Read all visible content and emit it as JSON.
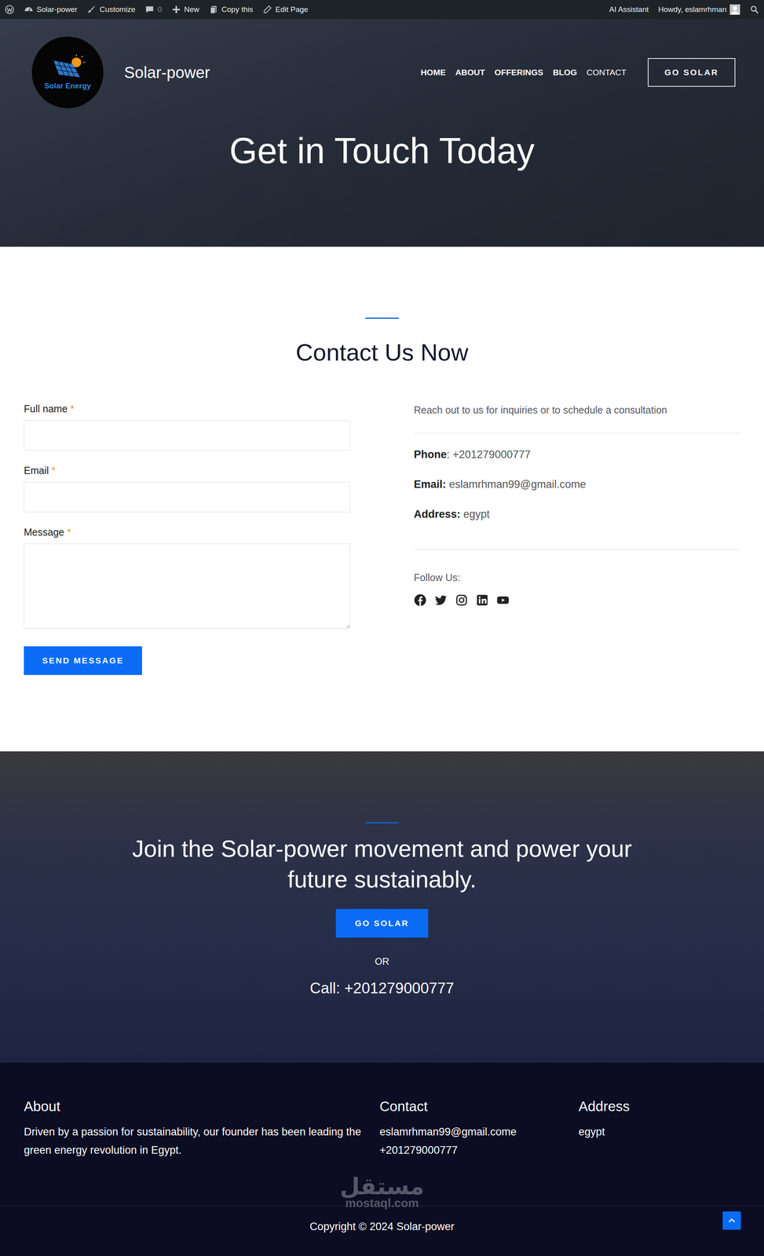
{
  "admin_bar": {
    "site": "Solar-power",
    "customize": "Customize",
    "comments": "0",
    "new": "New",
    "copy": "Copy this",
    "edit": "Edit Page",
    "assistant": "AI Assistant",
    "howdy": "Howdy, eslamrhman"
  },
  "header": {
    "logo_text": "Solar Energy",
    "site_title": "Solar-power",
    "nav": [
      {
        "label": "HOME",
        "selected": false
      },
      {
        "label": "ABOUT",
        "selected": false
      },
      {
        "label": "OFFERINGS",
        "selected": false
      },
      {
        "label": "BLOG",
        "selected": false
      },
      {
        "label": "CONTACT",
        "selected": true
      }
    ],
    "cta": "GO SOLAR"
  },
  "hero": {
    "title": "Get in Touch Today"
  },
  "contact": {
    "heading": "Contact Us Now",
    "fields": [
      {
        "label": "Full name",
        "required": "*",
        "kind": "input"
      },
      {
        "label": "Email",
        "required": "*",
        "kind": "input"
      },
      {
        "label": "Message",
        "required": "*",
        "kind": "textarea"
      }
    ],
    "submit": "SEND MESSAGE",
    "intro": "Reach out to us for inquiries or to schedule a consultation",
    "details": [
      {
        "label": "Phone",
        "value": ": +201279000777"
      },
      {
        "label": "Email:",
        "value": " eslamrhman99@gmail.come"
      },
      {
        "label": "Address:",
        "value": " egypt"
      }
    ],
    "follow": "Follow Us:",
    "social": [
      {
        "kind": "facebook"
      },
      {
        "kind": "twitter"
      },
      {
        "kind": "instagram"
      },
      {
        "kind": "linkedin"
      },
      {
        "kind": "youtube"
      }
    ]
  },
  "cta_band": {
    "heading": "Join the Solar-power movement and power your future sustainably.",
    "button": "GO SOLAR",
    "or": "OR",
    "call": "Call: +201279000777"
  },
  "footer": {
    "columns": [
      {
        "title": "About",
        "lines": [
          "Driven by a passion for sustainability, our founder has been leading the green energy revolution in Egypt."
        ]
      },
      {
        "title": "Contact",
        "lines": [
          "eslamrhman99@gmail.come",
          "+201279000777"
        ]
      },
      {
        "title": "Address",
        "lines": [
          "egypt"
        ]
      }
    ],
    "copyright": "Copyright © 2024 Solar-power",
    "watermark": {
      "arabic": "مستقل",
      "latin": "mostaql.com"
    }
  }
}
